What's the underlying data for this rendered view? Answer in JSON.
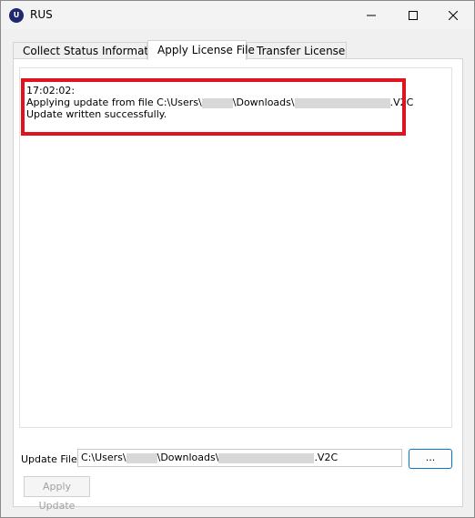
{
  "window": {
    "title": "RUS",
    "app_icon_letter": "U"
  },
  "tabs": [
    {
      "label": "Collect Status Information",
      "active": false
    },
    {
      "label": "Apply License File",
      "active": true
    },
    {
      "label": "Transfer License",
      "active": false
    }
  ],
  "log": {
    "time": "17:02:02:",
    "line2_prefix": "Applying update from file C:\\Users\\",
    "line2_mid": "\\Downloads\\",
    "line2_suffix": ".V2C",
    "line3": "Update written successfully."
  },
  "file": {
    "label": "Update File",
    "value_prefix": "C:\\Users\\",
    "value_mid": "\\Downloads\\",
    "value_suffix": ".V2C",
    "browse_label": "...",
    "apply_label": "Apply Update"
  },
  "colors": {
    "highlight": "#e0141e",
    "accent": "#0078d4",
    "app_icon": "#1f2a6e"
  }
}
